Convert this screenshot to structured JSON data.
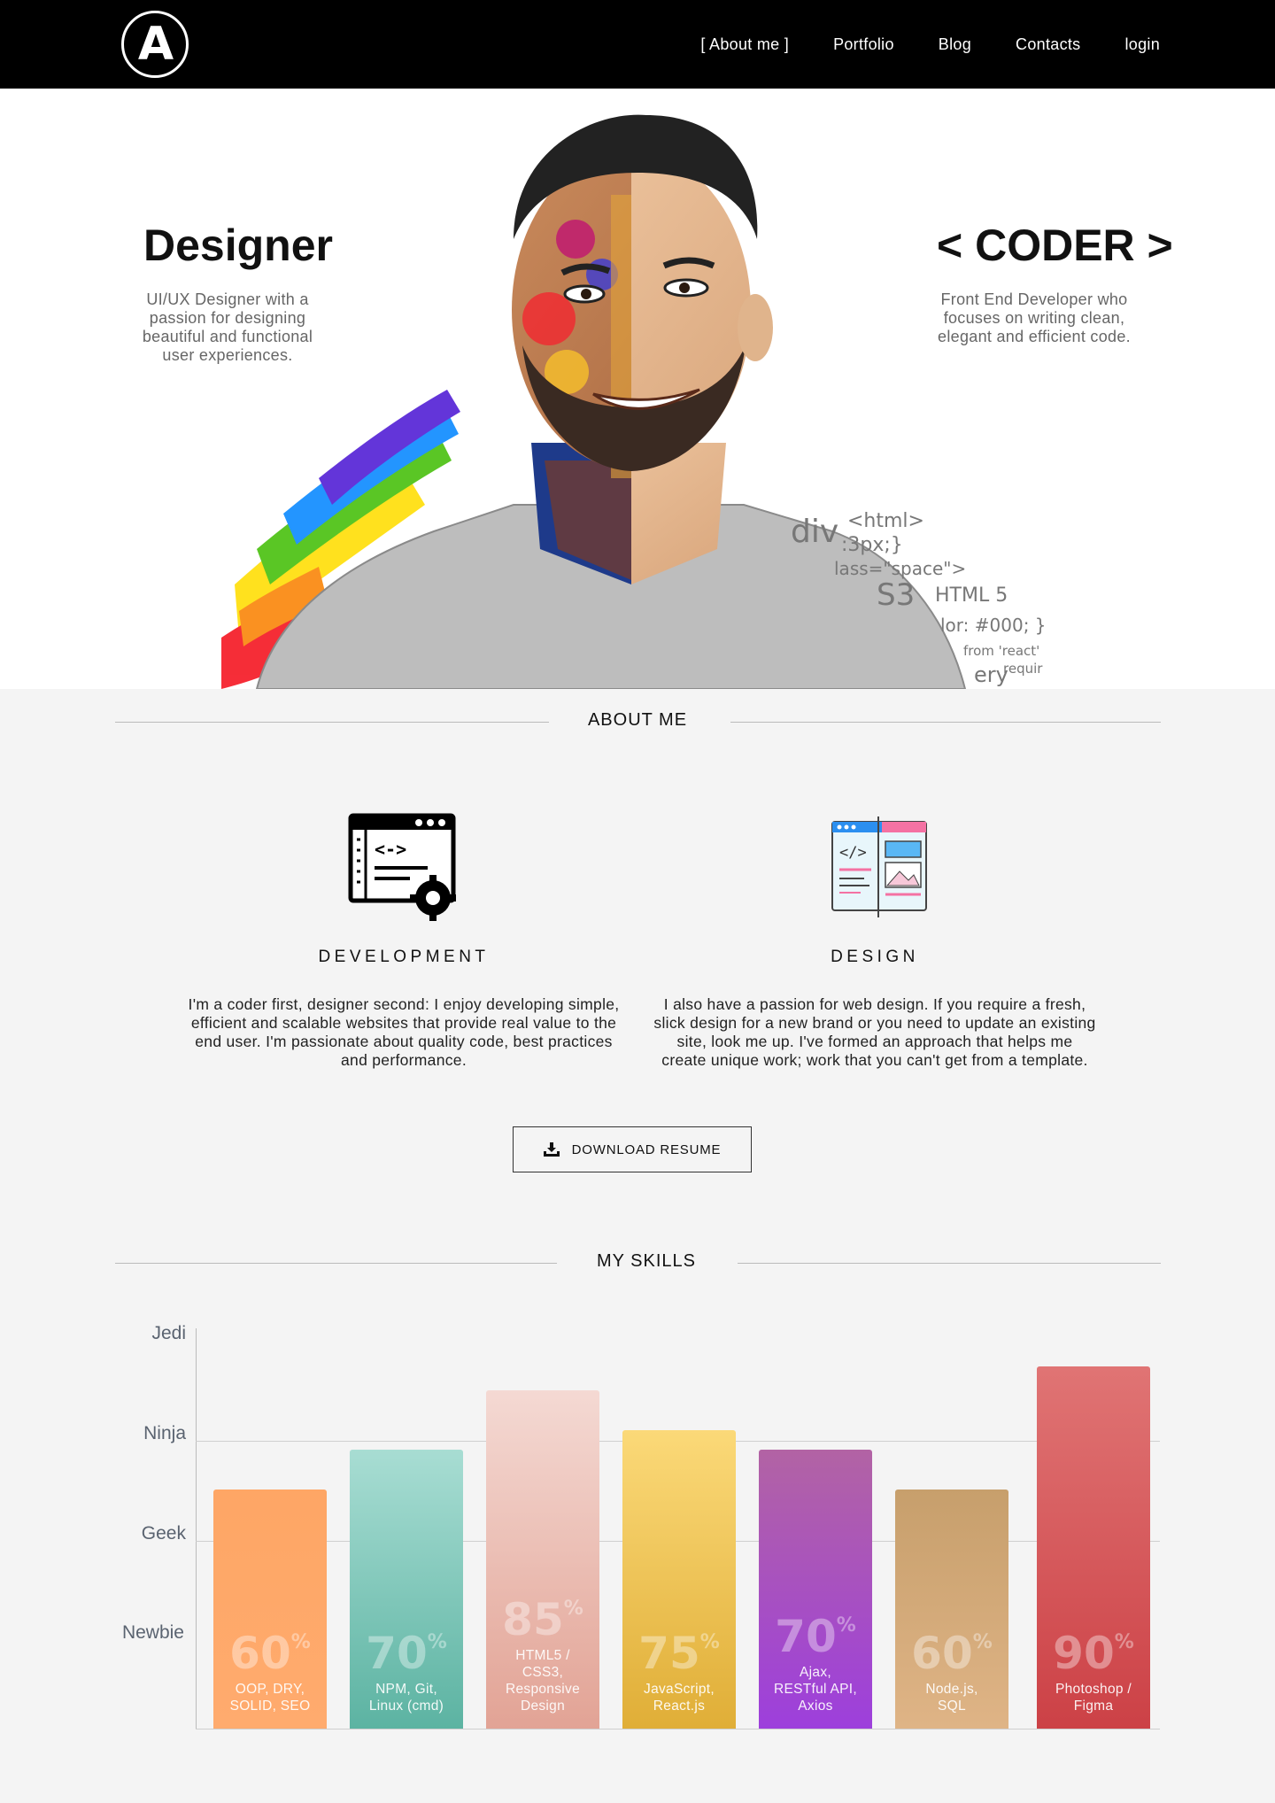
{
  "nav": {
    "logo_letter": "A",
    "links": [
      "[ About me ]",
      "Portfolio",
      "Blog",
      "Contacts",
      "login"
    ]
  },
  "hero": {
    "left_title": "Designer",
    "left_desc": "UI/UX Designer with a passion for designing beautiful and functional user experiences.",
    "right_title": "< CODER >",
    "right_desc": "Front End Developer who focuses on writing clean, elegant and efficient code.",
    "code_snippets": [
      "<html>",
      "div",
      ":3px;}",
      "lass=\"space\">",
      "S3",
      "HTML 5",
      "lor: #000; }",
      "from 'react'",
      "requir",
      "ery"
    ]
  },
  "about": {
    "heading": "ABOUT ME",
    "development": {
      "title": "DEVELOPMENT",
      "icon": "<->",
      "text": "I'm a coder first, designer second: I enjoy developing simple, efficient and scalable websites that provide real value to the end user. I'm passionate about quality code, best practices and performance."
    },
    "design": {
      "title": "DESIGN",
      "icon": "</>",
      "text": "I also have a passion for web design. If you require a fresh, slick design for a new brand or you need to update an existing site, look me up. I've formed an approach that helps me create unique work; work that you can't get from a template."
    },
    "download_label": "DOWNLOAD RESUME"
  },
  "skills": {
    "heading": "MY SKILLS"
  },
  "chart_data": {
    "type": "bar",
    "y_levels": [
      "Newbie",
      "Geek",
      "Ninja",
      "Jedi"
    ],
    "ylim": [
      0,
      100
    ],
    "categories": [
      "OOP, DRY, SOLID, SEO",
      "NPM, Git, Linux (cmd)",
      "HTML5 / CSS3, Responsive Design",
      "JavaScript, React.js",
      "Ajax, RESTful API, Axios",
      "Node.js, SQL",
      "Photoshop / Figma"
    ],
    "values": [
      60,
      70,
      85,
      75,
      70,
      60,
      90
    ],
    "labels": [
      [
        "OOP, DRY,",
        "SOLID, SEO"
      ],
      [
        "NPM, Git,",
        "Linux (cmd)"
      ],
      [
        "HTML5 /",
        "CSS3,",
        "Responsive",
        "Design"
      ],
      [
        "JavaScript,",
        "React.js"
      ],
      [
        "Ajax,",
        "RESTful API,",
        "Axios"
      ],
      [
        "Node.js,",
        "SQL"
      ],
      [
        "Photoshop /",
        "Figma"
      ]
    ],
    "colors": [
      [
        "#fea665",
        "#ffab6e"
      ],
      [
        "#a8ddd3",
        "#5cb3a2"
      ],
      [
        "#f4d9d3",
        "#e2a395"
      ],
      [
        "#fbd978",
        "#e0ae37"
      ],
      [
        "#b263a4",
        "#9d3fdc"
      ],
      [
        "#c79f6c",
        "#dfb486"
      ],
      [
        "#e07474",
        "#cc4146"
      ]
    ],
    "unit": "%"
  }
}
